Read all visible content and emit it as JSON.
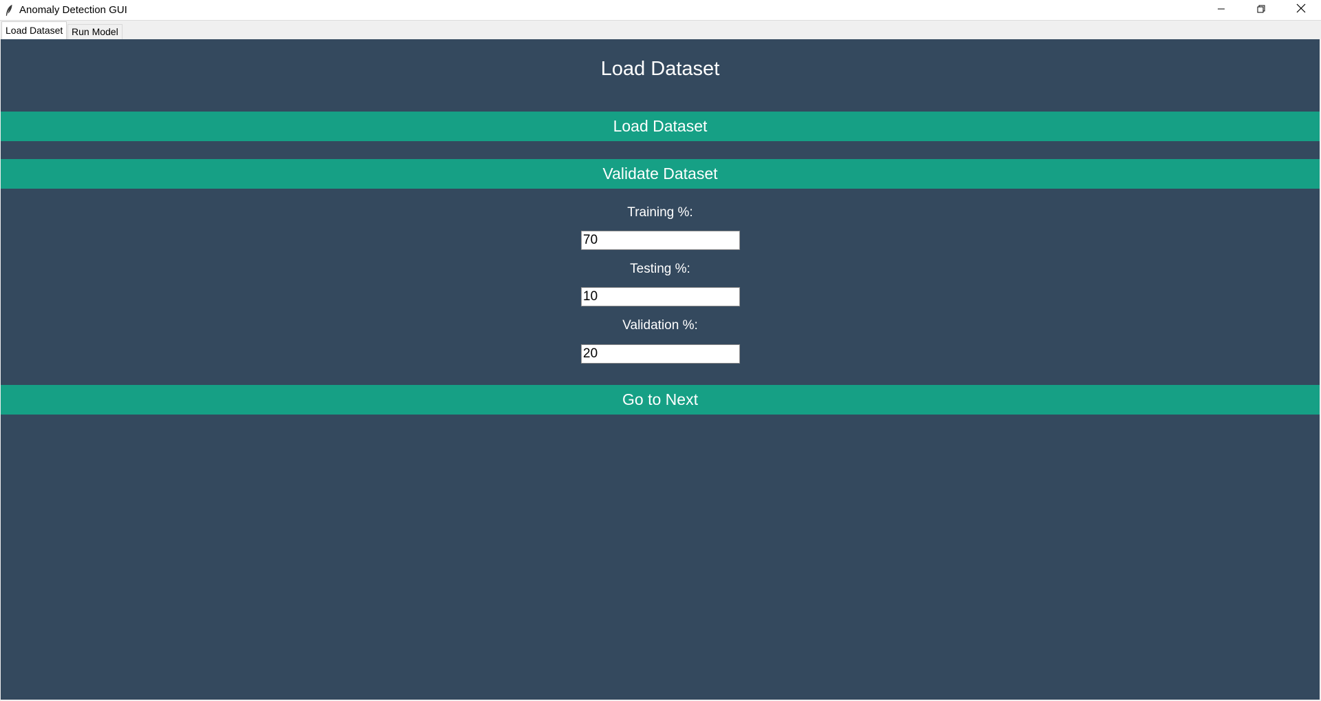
{
  "window": {
    "title": "Anomaly Detection GUI"
  },
  "tabs": [
    {
      "label": "Load Dataset",
      "active": true
    },
    {
      "label": "Run Model",
      "active": false
    }
  ],
  "main": {
    "heading": "Load Dataset",
    "load_button": "Load Dataset",
    "validate_button": "Validate Dataset",
    "next_button": "Go to Next",
    "fields": {
      "training": {
        "label": "Training %:",
        "value": "70"
      },
      "testing": {
        "label": "Testing %:",
        "value": "10"
      },
      "validation": {
        "label": "Validation %:",
        "value": "20"
      }
    }
  },
  "colors": {
    "background": "#34495e",
    "button": "#16a085",
    "text": "#ffffff"
  },
  "icons": {
    "app": "feather-icon",
    "minimize": "minimize-icon",
    "maximize": "restore-icon",
    "close": "close-icon"
  }
}
